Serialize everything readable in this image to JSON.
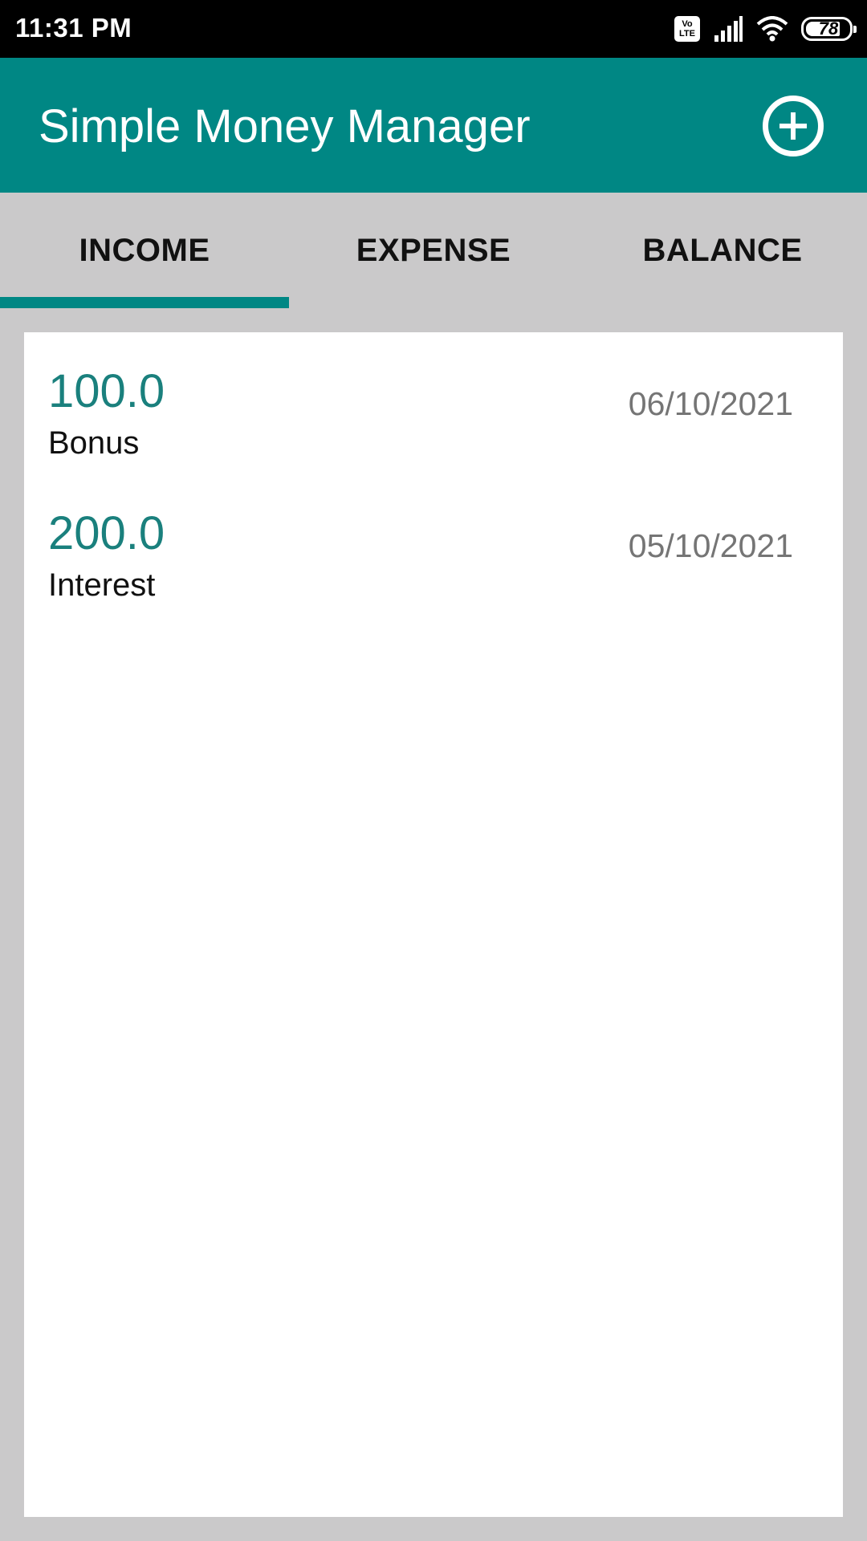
{
  "status_bar": {
    "time": "11:31 PM",
    "volte_label": "Vo LTE",
    "signal_icon": "signal-bars-icon",
    "wifi_icon": "wifi-icon",
    "battery_level": "78"
  },
  "app_bar": {
    "title": "Simple Money Manager",
    "add_icon": "add-circle-icon"
  },
  "tabs": [
    {
      "label": "INCOME",
      "selected": true
    },
    {
      "label": "EXPENSE",
      "selected": false
    },
    {
      "label": "BALANCE",
      "selected": false
    }
  ],
  "entries": [
    {
      "amount": "100.0",
      "category": "Bonus",
      "date": "06/10/2021"
    },
    {
      "amount": "200.0",
      "category": "Interest",
      "date": "05/10/2021"
    }
  ],
  "colors": {
    "primary": "#008784",
    "amount_text": "#1a807d",
    "background": "#cac9ca",
    "date_text": "#757575"
  }
}
